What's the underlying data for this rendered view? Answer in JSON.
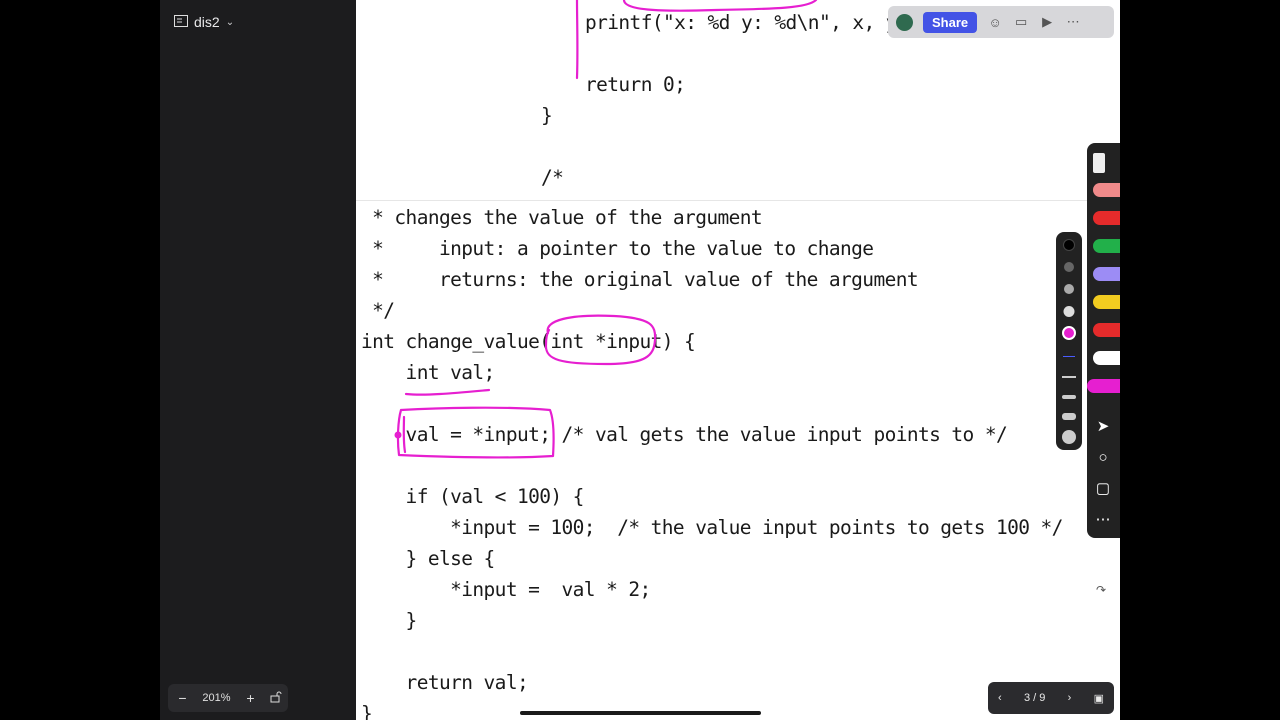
{
  "sidebar": {
    "doc_title": "dis2",
    "zoom_out": "−",
    "zoom_level": "201%",
    "zoom_in": "+"
  },
  "code": {
    "top_block": [
      "printf(\"x: %d y: %d\\n\", x, y",
      "return 0;",
      "}",
      "/*"
    ],
    "main_block": [
      " * changes the value of the argument",
      " *     input: a pointer to the value to change",
      " *     returns: the original value of the argument",
      " */",
      "int change_value(int *input) {",
      "    int val;",
      "",
      "    val = *input; /* val gets the value input points to */",
      "",
      "    if (val < 100) {",
      "        *input = 100;  /* the value input points to gets 100 */",
      "    } else {",
      "        *input =  val * 2;",
      "    }",
      "",
      "    return val;",
      "}"
    ]
  },
  "collab_bar": {
    "share_label": "Share"
  },
  "pager": {
    "page_label": "3 / 9"
  },
  "colors": {
    "ink": "#e61fd0",
    "share": "#4353e6",
    "sidebar_bg": "#1c1c1e"
  }
}
